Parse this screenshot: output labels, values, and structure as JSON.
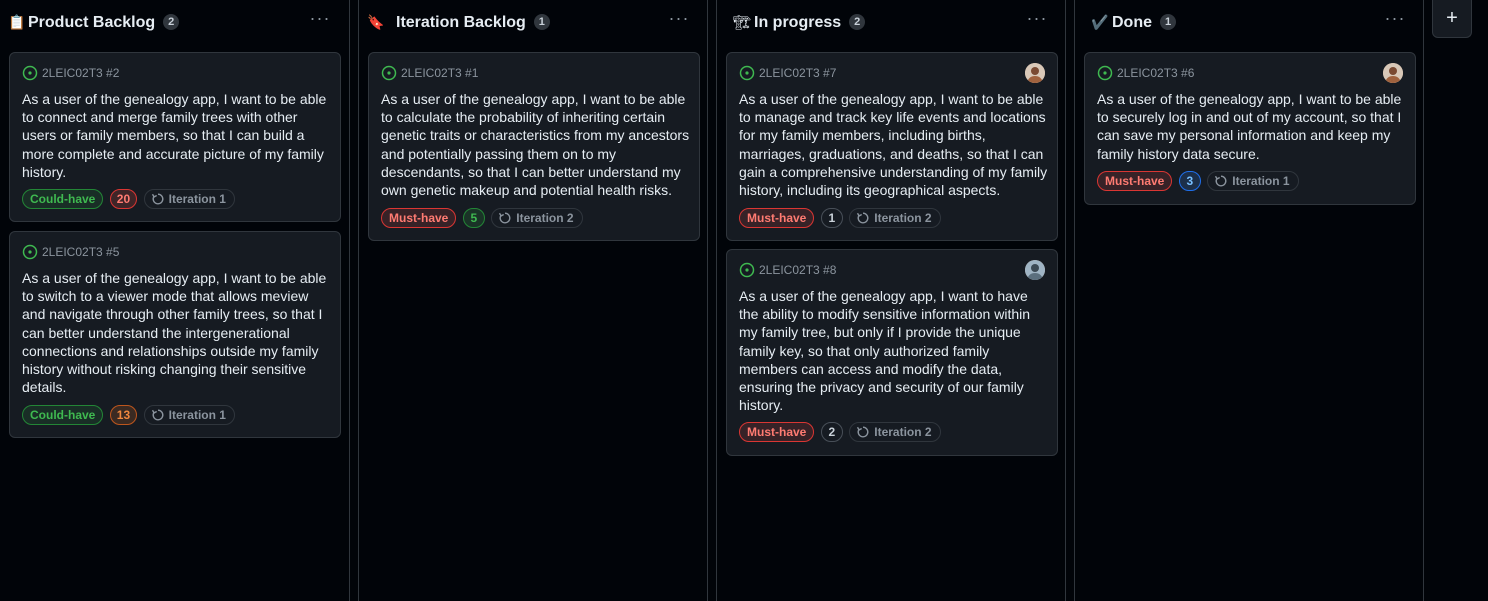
{
  "columns": [
    {
      "icon": "📋",
      "icon_name": "clipboard-icon",
      "title": "Product Backlog",
      "count": "2",
      "cards": [
        {
          "ref": "2LEIC02T3 #2",
          "body": "As a user of the genealogy app, I want to be able to connect and merge family trees with other users or family members, so that I can build a more complete and accurate picture of my family history.",
          "priority": "Could-have",
          "estimate": "20",
          "iteration": "Iteration 1"
        },
        {
          "ref": "2LEIC02T3 #5",
          "body": "As a user of the genealogy app, I want to be able to switch to a viewer mode that allows meview and navigate through other family trees, so that I can better understand the intergenerational connections and relationships outside my family history without risking changing their sensitive details.",
          "priority": "Could-have",
          "estimate": "13",
          "iteration": "Iteration 1"
        }
      ]
    },
    {
      "icon": "🔖",
      "icon_name": "bookmark-icon",
      "title": "Iteration Backlog",
      "count": "1",
      "cards": [
        {
          "ref": "2LEIC02T3 #1",
          "body": "As a user of the genealogy app, I want to be able to calculate the probability of inheriting certain genetic traits or characteristics from my ancestors and potentially passing them on to my descendants, so that I can better understand my own genetic makeup and potential health risks.",
          "priority": "Must-have",
          "estimate": "5",
          "iteration": "Iteration 2"
        }
      ]
    },
    {
      "icon": "🏗",
      "icon_name": "construction-icon",
      "title": "In progress",
      "count": "2",
      "cards": [
        {
          "ref": "2LEIC02T3 #7",
          "body": "As a user of the genealogy app, I want to be able to manage and track key life events and locations for my family members, including births, marriages, graduations, and deaths, so that I can gain a comprehensive understanding of my family history, including its geographical aspects.",
          "priority": "Must-have",
          "estimate": "1",
          "iteration": "Iteration 2"
        },
        {
          "ref": "2LEIC02T3 #8",
          "body": "As a user of the genealogy app, I want to have the ability to modify sensitive information within my family tree, but only if I provide the unique family key, so that only authorized family members can access and modify the data, ensuring the privacy and security of our family history.",
          "priority": "Must-have",
          "estimate": "2",
          "iteration": "Iteration 2"
        }
      ]
    },
    {
      "icon": "✔️",
      "icon_name": "check-icon",
      "title": "Done",
      "count": "1",
      "cards": [
        {
          "ref": "2LEIC02T3 #6",
          "body": "As a user of the genealogy app, I want to be able to securely log in and out of my account, so that I can save my personal information and keep my family history data secure.",
          "priority": "Must-have",
          "estimate": "3",
          "iteration": "Iteration 1"
        }
      ]
    }
  ],
  "menu_glyph": "···",
  "add_column_glyph": "+",
  "colors": {
    "background": "#010409",
    "card": "#161b22",
    "border": "#30363d",
    "open_issue": "#3fb950",
    "must_have": "#ff7b72",
    "could_have": "#3fb950"
  }
}
